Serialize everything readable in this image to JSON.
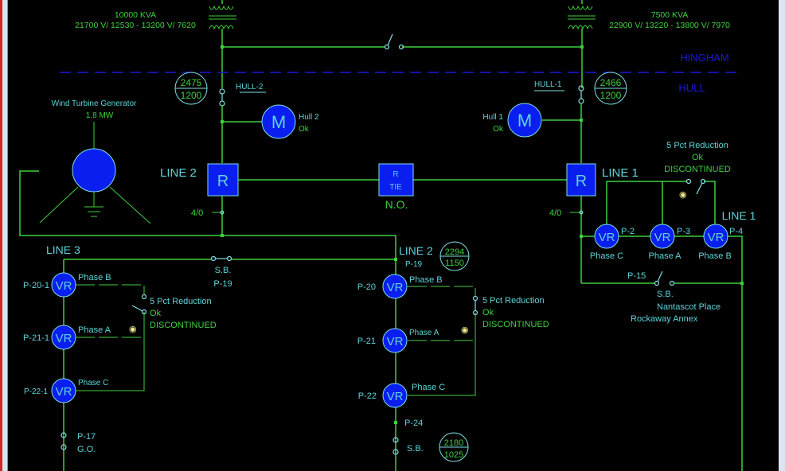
{
  "colors": {
    "background": "#000000",
    "wire": "#3ed03e",
    "label_cyan": "#5fd3d8",
    "label_green": "#3ed03e",
    "equipment_fill": "#0a1eef",
    "boundary_blue": "#1a1ad8",
    "lock_yellow": "#f0e68c"
  },
  "transformers": [
    {
      "id": "left",
      "kva": "10000 KVA",
      "voltage": "21700 V/ 12530 - 13200 V/ 7620"
    },
    {
      "id": "right",
      "kva": "7500 KVA",
      "voltage": "22900 V/ 13220 - 13800 V/ 7970"
    }
  ],
  "boundary": {
    "north": "HINGHAM",
    "south": "HULL"
  },
  "feeders": {
    "hull2": {
      "tag": "HULL-2",
      "meter_top": "2475",
      "meter_bottom": "1200",
      "motor_label": "M",
      "motor_name": "Hull 2",
      "motor_status": "Ok"
    },
    "hull1": {
      "tag": "HULL-1",
      "meter_top": "2466",
      "meter_bottom": "1200",
      "motor_label": "M",
      "motor_name": "Hull 1",
      "motor_status": "Ok"
    }
  },
  "wind_turbine": {
    "title": "Wind Turbine Generator",
    "rating": "1.8 MW"
  },
  "reclosers": {
    "line2": {
      "symbol": "R",
      "label": "LINE 2",
      "conductor": "4/0"
    },
    "line1": {
      "symbol": "R",
      "label": "LINE 1",
      "conductor": "4/0"
    },
    "tie": {
      "symbol": "R",
      "sub": "TIE",
      "status": "N.O."
    }
  },
  "line1_regulators": {
    "label": "LINE 1",
    "reduction": {
      "title": "5 Pct Reduction",
      "status": "Ok",
      "state": "DISCONTINUED"
    },
    "units": [
      {
        "symbol": "VR",
        "pole": "P-2",
        "phase": "Phase C"
      },
      {
        "symbol": "VR",
        "pole": "P-3",
        "phase": "Phase A"
      },
      {
        "symbol": "VR",
        "pole": "P-4",
        "phase": "Phase B"
      }
    ],
    "switch": {
      "pole": "P-15",
      "type": "S.B.",
      "location1": "Nantascot Place",
      "location2": "Rockaway Annex"
    }
  },
  "line3_regulators": {
    "label": "LINE 3",
    "tie_switch": {
      "type": "S.B.",
      "pole": "P-19"
    },
    "reduction": {
      "title": "5 Pct Reduction",
      "status": "Ok",
      "state": "DISCONTINUED"
    },
    "units": [
      {
        "symbol": "VR",
        "pole": "P-20-1",
        "phase": "Phase B"
      },
      {
        "symbol": "VR",
        "pole": "P-21-1",
        "phase": "Phase A"
      },
      {
        "symbol": "VR",
        "pole": "P-22-1",
        "phase": "Phase C"
      }
    ],
    "cutout": {
      "pole": "P-17",
      "type": "G.O."
    }
  },
  "line2_regulators": {
    "label": "LINE 2",
    "pole": "P-19",
    "meter_top": "2294",
    "meter_bottom": "1150",
    "reduction": {
      "title": "5 Pct Reduction",
      "status": "Ok",
      "state": "DISCONTINUED"
    },
    "units": [
      {
        "symbol": "VR",
        "pole": "P-20",
        "phase": "Phase B"
      },
      {
        "symbol": "VR",
        "pole": "P-21",
        "phase": "Phase A"
      },
      {
        "symbol": "VR",
        "pole": "P-22",
        "phase": "Phase C"
      }
    ],
    "downstream": {
      "pole": "P-24",
      "type": "S.B.",
      "meter_top": "2180",
      "meter_bottom": "1025"
    }
  }
}
